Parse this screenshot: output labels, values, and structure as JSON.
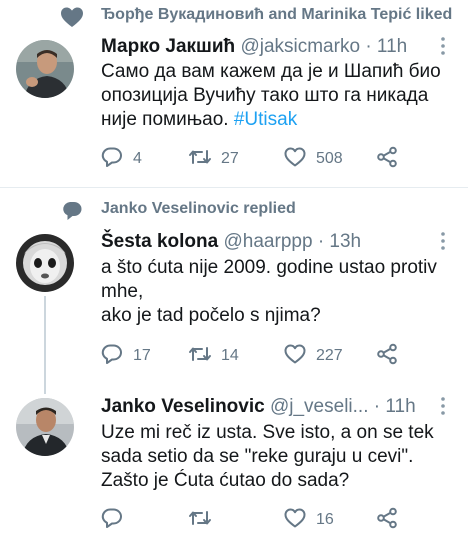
{
  "tweet1": {
    "context": "Ђорђе Вукадиновић and Marinika Tepić liked",
    "name": "Марко Јакшић",
    "handle": "@jaksicmarko",
    "sep": "·",
    "time": "11h",
    "text_line1": "Само да вам кажем да је и Шапић био",
    "text_line2": "опозиција Вучићу тако што га никада",
    "text_line3_pre": "није помињао. ",
    "hashtag": "#Utisak",
    "replies": "4",
    "retweets": "27",
    "likes": "508"
  },
  "tweet2": {
    "context": "Janko Veselinovic replied",
    "name": "Šesta kolona",
    "handle": "@haarppp",
    "sep": "·",
    "time": "13h",
    "text_line1": "a što ćuta nije 2009. godine ustao protiv",
    "text_line2": "mhe,",
    "text_line3": "ako je tad počelo s njima?",
    "replies": "17",
    "retweets": "14",
    "likes": "227"
  },
  "tweet3": {
    "name": "Janko Veselinovic",
    "handle": "@j_veseli...",
    "sep": "·",
    "time": "11h",
    "text_line1": "Uze mi reč iz usta. Sve isto, a on se tek",
    "text_line2": "sada setio da se \"reke guraju u cevi\".",
    "text_line3": "Zašto je Ćuta ćutao do sada?",
    "replies": "",
    "retweets": "",
    "likes": "16"
  },
  "icons": {
    "heart": "heart-icon",
    "comment": "comment-icon",
    "retweet": "retweet-icon",
    "share": "share-icon",
    "more": "more-icon"
  },
  "colors": {
    "text": "#14171a",
    "secondary": "#657786",
    "hashtag": "#1da1f2",
    "divider": "#e6ecf0"
  }
}
